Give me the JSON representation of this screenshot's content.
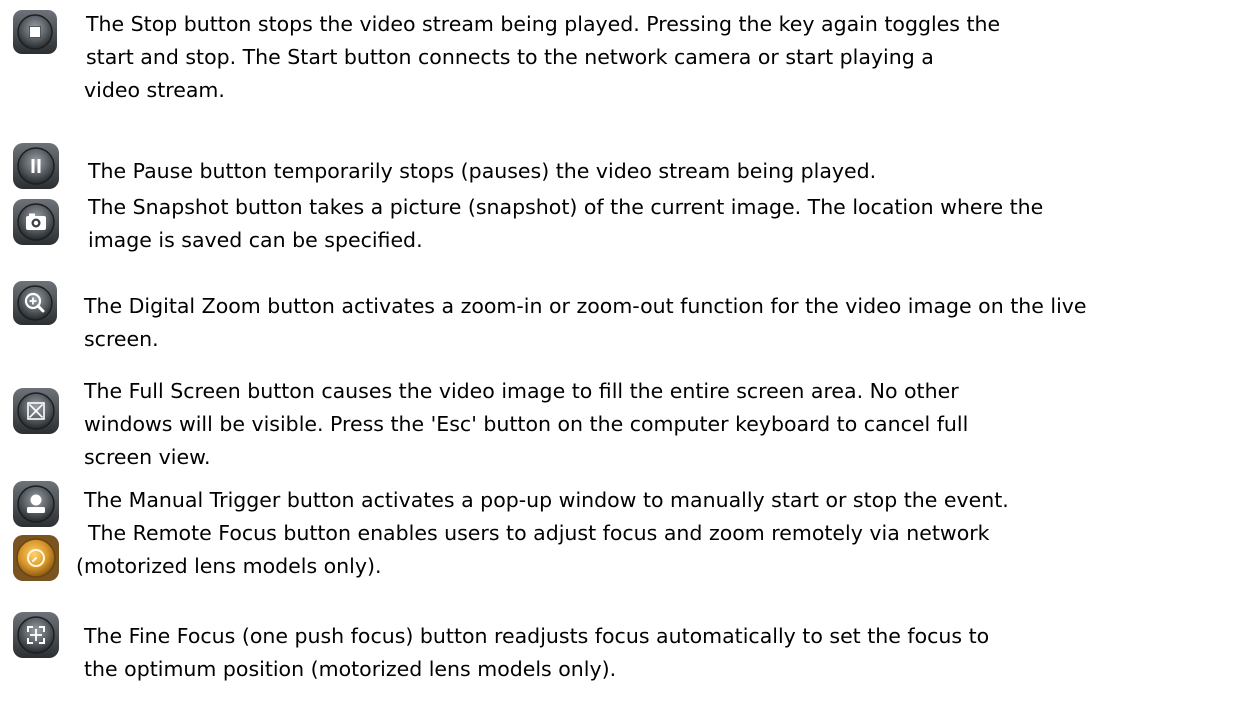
{
  "buttons": [
    {
      "icon": "stop-icon",
      "lines": [
        "The Stop button stops the video stream being played. Pressing the key again toggles the",
        "start and stop. The Start button connects to the network camera or start playing a",
        "video stream."
      ]
    },
    {
      "icon": "pause-icon",
      "lines": [
        "The Pause button temporarily stops (pauses) the video stream being played."
      ]
    },
    {
      "icon": "camera-icon",
      "lines": [
        "The Snapshot button takes a picture (snapshot) of the current image. The location where the",
        "image is saved can be specified."
      ]
    },
    {
      "icon": "zoom-in-icon",
      "lines": [
        "The Digital Zoom button activates a zoom-in or zoom-out function for the video image on the live",
        "screen."
      ]
    },
    {
      "icon": "fullscreen-icon",
      "lines": [
        "The Full Screen button causes the video image to fill the entire screen area. No other",
        "windows will be visible. Press the 'Esc' button on the computer keyboard to cancel full",
        "screen view."
      ]
    },
    {
      "icon": "trigger-icon",
      "lines": [
        "The Manual Trigger button activates a pop-up window to manually start or stop the event."
      ]
    },
    {
      "icon": "remote-focus-icon",
      "lines": [
        "The Remote Focus button enables users to adjust focus and zoom remotely via network",
        "(motorized lens models only)."
      ]
    },
    {
      "icon": "fine-focus-icon",
      "lines": [
        "The Fine Focus (one push focus) button readjusts focus automatically to set the focus to",
        "the optimum position (motorized lens models only)."
      ]
    }
  ]
}
